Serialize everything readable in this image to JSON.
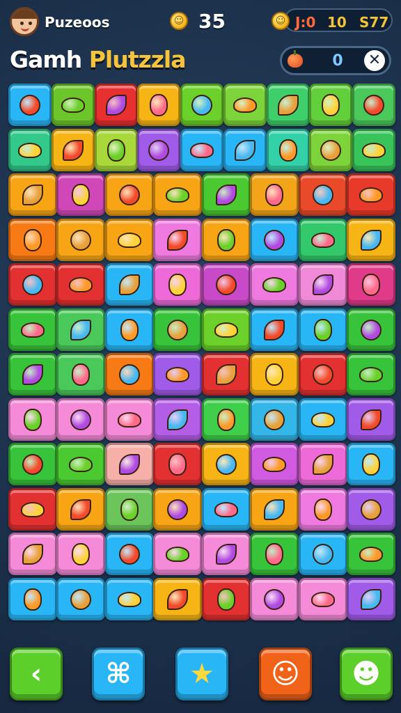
{
  "header": {
    "player_name": "Puzeoos",
    "avatar_icon": "player-avatar-icon",
    "coins": "35",
    "stats": [
      "J:0",
      "10",
      "S77"
    ]
  },
  "title": {
    "part1": "Gamh",
    "part2": "Plutzzla"
  },
  "score": {
    "value": "0",
    "close_symbol": "✕"
  },
  "board": {
    "rows": 12,
    "cols": 9,
    "tiles": [
      [
        "#29b6f6",
        "#6cc52a",
        "#e83030",
        "#f7b515",
        "#6cd02a",
        "#7dd43a",
        "#3fcf6a",
        "#62d03a",
        "#4ac95a"
      ],
      [
        "#33c98a",
        "#f7b515",
        "#a8d83a",
        "#a05be8",
        "#29b6f6",
        "#29b6f6",
        "#33d1a8",
        "#7dd43a",
        "#38c45a"
      ],
      [
        "#f7a515",
        "#d048b8",
        "#f7a515",
        "#f7a515",
        "#4ac930",
        "#f2a518",
        "#e84a2a",
        "#e83a2a"
      ],
      [
        "#f77a15",
        "#f7a515",
        "#f7a515",
        "#ee7ae0",
        "#f7a515",
        "#29b6f6",
        "#33c96a",
        "#f7b515"
      ],
      [
        "#e33030",
        "#e33030",
        "#29b6f6",
        "#ee6ad8",
        "#c84ac8",
        "#ee7ae0",
        "#f08ad8",
        "#e03a8a"
      ],
      [
        "#38c43a",
        "#4ac95a",
        "#29b6f6",
        "#38c43a",
        "#6cd02a",
        "#29b6f6",
        "#29b6f6",
        "#38c43a"
      ],
      [
        "#38c43a",
        "#4ac95a",
        "#f77a15",
        "#a05be8",
        "#e33030",
        "#f7b515",
        "#e33030",
        "#38c43a"
      ],
      [
        "#f58ad8",
        "#f58ad8",
        "#f58ad8",
        "#b45ee8",
        "#3fcf4a",
        "#33b6e8",
        "#29b6f6",
        "#a05be8"
      ],
      [
        "#38c43a",
        "#4ac930",
        "#f7b0a8",
        "#e33030",
        "#f7b515",
        "#d05ae0",
        "#ee6ad8",
        "#29b6f6"
      ],
      [
        "#e33030",
        "#f7a515",
        "#6cc55a",
        "#f7a515",
        "#29b6f6",
        "#f7a515",
        "#ee7ae0",
        "#a05be8"
      ],
      [
        "#f58ad8",
        "#f58ad8",
        "#29b6f6",
        "#f58ad8",
        "#f58ad8",
        "#38c43a",
        "#29b6f6",
        "#38c43a"
      ],
      [
        "#29b6f6",
        "#29b6f6",
        "#29b6f6",
        "#f7b515",
        "#e33030",
        "#f58ad8",
        "#f58ad8",
        "#a05be8"
      ]
    ]
  },
  "bottom_bar": {
    "buttons": [
      {
        "icon": "back-arrow-icon",
        "glyph": "‹",
        "color": "#5ccf2a"
      },
      {
        "icon": "puzzle-piece-icon",
        "glyph": "⌘",
        "color": "#29b6f6"
      },
      {
        "icon": "star-icon",
        "glyph": "★",
        "color": "#29b6f6"
      },
      {
        "icon": "face-icon",
        "glyph": "☺",
        "color": "#f2631a"
      },
      {
        "icon": "character-icon",
        "glyph": "☻",
        "color": "#5ccf2a"
      }
    ]
  }
}
